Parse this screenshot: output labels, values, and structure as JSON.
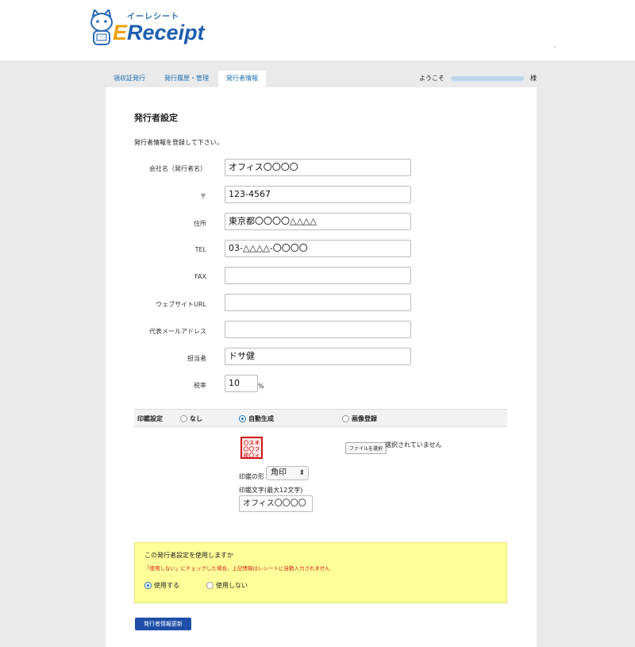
{
  "logo": {
    "kana": "イーレシート",
    "brand_e": "E",
    "brand_rest": "Receipt"
  },
  "nav": {
    "tabs": [
      {
        "label": "領収証発行"
      },
      {
        "label": "発行履歴・管理"
      },
      {
        "label": "発行者情報"
      }
    ],
    "welcome": "ようこそ",
    "honorific": "様"
  },
  "form": {
    "title": "発行者設定",
    "intro": "発行者情報を登録して下さい。",
    "fields": [
      {
        "label": "会社名（発行者名）",
        "value": "オフィス〇〇〇〇"
      },
      {
        "label": "〒",
        "value": "123-4567"
      },
      {
        "label": "住所",
        "value": "東京都〇〇〇〇△△△△"
      },
      {
        "label": "TEL",
        "value": "03-△△△△-〇〇〇〇"
      },
      {
        "label": "FAX",
        "value": ""
      },
      {
        "label": "ウェブサイトURL",
        "value": ""
      },
      {
        "label": "代表メールアドレス",
        "value": ""
      },
      {
        "label": "担当者",
        "value": "ドサ健"
      },
      {
        "label": "税率",
        "value": "10"
      }
    ],
    "tax_unit": "%"
  },
  "stamp": {
    "label": "印鑑設定",
    "options": [
      "なし",
      "自動生成",
      "画像登録"
    ],
    "selected": "自動生成",
    "preview_chars": [
      "オ",
      "フ",
      "ィ",
      "ス",
      "〇",
      "〇",
      "〇",
      "〇",
      "印"
    ],
    "file_button": "ファイルを選択",
    "file_status": "選択されていません",
    "shape_label": "印鑑の形",
    "shape_value": "角印",
    "text_label": "印鑑文字(最大12文字)",
    "text_value": "オフィス〇〇〇〇"
  },
  "usage": {
    "question": "この発行者設定を使用しますか",
    "warning": "「使用しない」にチェックした場合、上記情報はレシートに自動入力されません",
    "options": [
      "使用する",
      "使用しない"
    ],
    "selected": "使用する"
  },
  "submit_label": "発行者情報更新",
  "colors": {
    "brand_blue": "#1d6fb3",
    "button_blue": "#1f4fa8",
    "warning_red": "#d01818",
    "notice_bg": "#ffff99"
  }
}
